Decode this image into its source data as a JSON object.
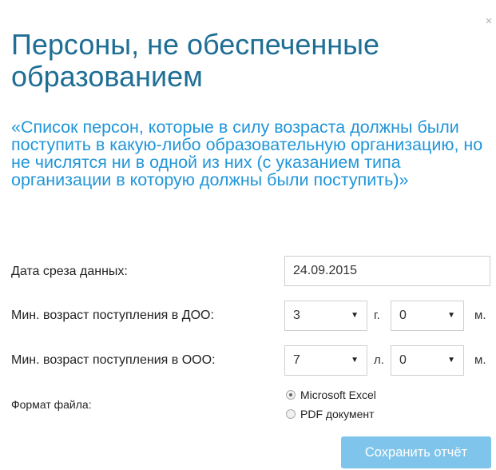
{
  "dialog": {
    "close_icon": "close-icon",
    "title": "Персоны, не обеспеченные образованием",
    "description": "«Список персон, которые в силу возраста должны были поступить в какую-либо образовательную организацию, но не числятся ни в одной из них (с указанием типа организации в которую должны были поступить)»"
  },
  "form": {
    "date": {
      "label": "Дата среза данных:",
      "value": "24.09.2015"
    },
    "doo": {
      "label": "Мин. возраст поступления в ДОО:",
      "years": "3",
      "years_unit": "г.",
      "months": "0",
      "months_unit": "м."
    },
    "ooo": {
      "label": "Мин. возраст поступления в ООО:",
      "years": "7",
      "years_unit": "л.",
      "months": "0",
      "months_unit": "м."
    },
    "format": {
      "label": "Формат файла:",
      "options": [
        "Microsoft Excel",
        "PDF документ"
      ],
      "selected": "Microsoft Excel"
    }
  },
  "actions": {
    "save_label": "Сохранить отчёт"
  },
  "colors": {
    "title": "#1f6e95",
    "description": "#2196d8",
    "button": "#7fc4ea"
  }
}
